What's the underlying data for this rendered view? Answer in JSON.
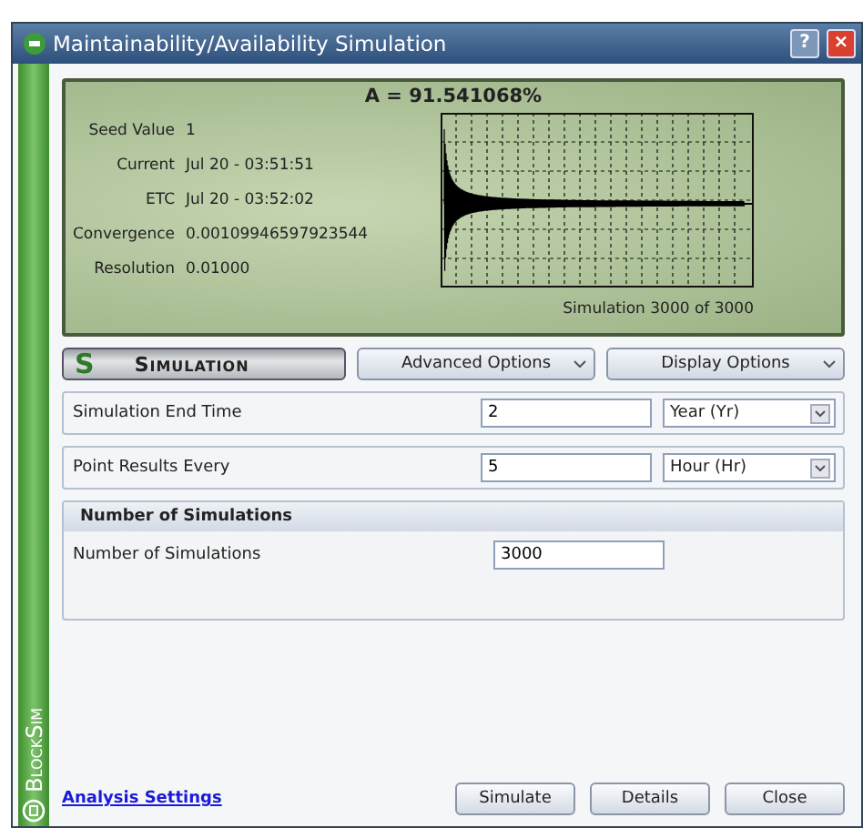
{
  "window": {
    "title": "Maintainability/Availability Simulation",
    "buttons": [
      "?",
      "×"
    ]
  },
  "side_brand": "BlockSim",
  "status_panel": {
    "headline": "A = 91.541068%",
    "fields": [
      {
        "label": "Seed Value",
        "value": "1"
      },
      {
        "label": "Current",
        "value": "Jul 20 - 03:51:51"
      },
      {
        "label": "ETC",
        "value": "Jul 20 - 03:52:02"
      },
      {
        "label": "Convergence",
        "value": "0.00109946597923544"
      },
      {
        "label": "Resolution",
        "value": "0.01000"
      }
    ],
    "progress": "Simulation 3000 of 3000"
  },
  "tabs": [
    {
      "label": "Simulation",
      "icon": "S",
      "selected": true
    },
    {
      "label": "Advanced Options",
      "selected": false
    },
    {
      "label": "Display Options",
      "selected": false
    }
  ],
  "rows": [
    {
      "label": "Simulation End Time",
      "value": "2",
      "unit": "Year (Yr)"
    },
    {
      "label": "Point Results Every",
      "value": "5",
      "unit": "Hour (Hr)"
    }
  ],
  "group": {
    "title": "Number of Simulations",
    "label": "Number of Simulations",
    "value": "3000"
  },
  "link": "Analysis Settings",
  "buttons": [
    "Simulate",
    "Details",
    "Close"
  ]
}
